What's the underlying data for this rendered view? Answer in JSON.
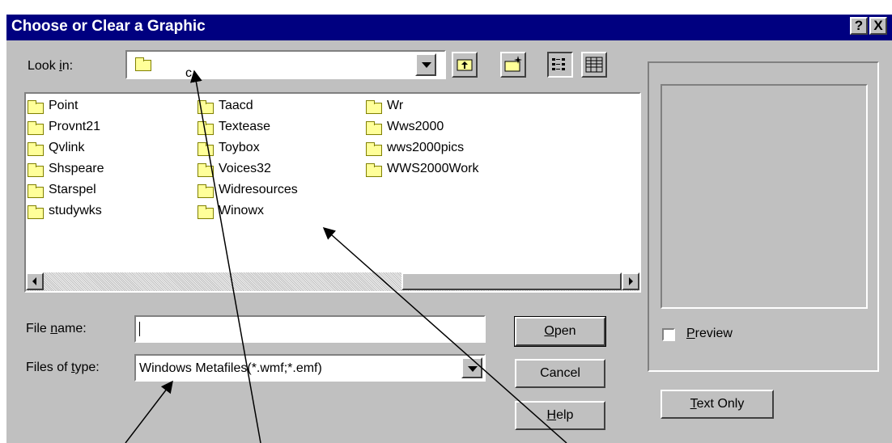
{
  "window": {
    "title": "Choose or Clear a Graphic",
    "help_button": "?",
    "close_button": "X"
  },
  "lookin": {
    "label_prefix": "Look ",
    "label_hotkey": "i",
    "label_suffix": "n:",
    "value": "c"
  },
  "files": [
    {
      "name": "Point"
    },
    {
      "name": "Provnt21"
    },
    {
      "name": "Qvlink"
    },
    {
      "name": "Shspeare"
    },
    {
      "name": "Starspel"
    },
    {
      "name": "studywks"
    },
    {
      "name": "Taacd"
    },
    {
      "name": "Textease"
    },
    {
      "name": "Toybox"
    },
    {
      "name": "Voices32"
    },
    {
      "name": "Widresources"
    },
    {
      "name": "Winowx"
    },
    {
      "name": "Wr"
    },
    {
      "name": "Wws2000"
    },
    {
      "name": "wws2000pics"
    },
    {
      "name": "WWS2000Work"
    }
  ],
  "filename": {
    "label_prefix": "File ",
    "label_hotkey": "n",
    "label_suffix": "ame:",
    "value": ""
  },
  "filetype": {
    "label_prefix": "Files of ",
    "label_hotkey": "t",
    "label_suffix": "ype:",
    "value": "Windows Metafiles(*.wmf;*.emf)"
  },
  "buttons": {
    "open_hotkey": "O",
    "open_rest": "pen",
    "cancel": "Cancel",
    "help_hotkey": "H",
    "help_rest": "elp",
    "textonly_hotkey": "T",
    "textonly_rest": "ext Only"
  },
  "preview": {
    "hotkey": "P",
    "rest": "review",
    "checked": false
  },
  "colors": {
    "titlebar": "#000080",
    "dialog": "#c0c0c0",
    "folder": "#ffff99"
  }
}
